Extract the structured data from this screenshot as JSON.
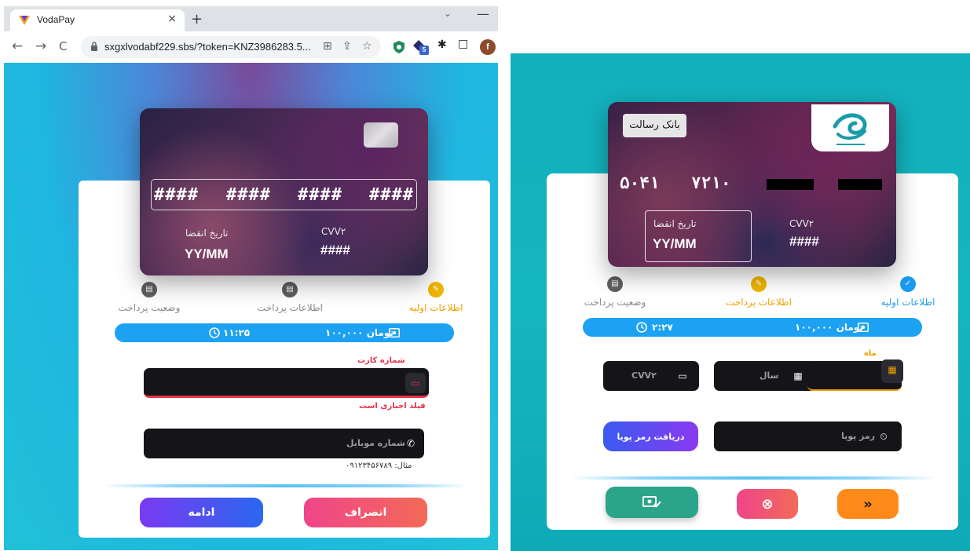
{
  "browser": {
    "tab_title": "VodaPay",
    "tab_close": "×",
    "new_tab": "+",
    "tabstrip_menu": "⌄",
    "window_minimize": "—",
    "back": "←",
    "forward": "→",
    "reload": "C",
    "url": "sxgxlvodabf229.sbs/?token=KNZ3986283.5...",
    "profile_initial": "f",
    "star": "☆",
    "translate": "⊞",
    "share": "⇪",
    "puzzle": "✱",
    "sidepanel": "□",
    "extension_badge": "5"
  },
  "left": {
    "card": {
      "groups": [
        "####",
        "####",
        "####",
        "####"
      ],
      "expiry_label": "تاریخ انقضا",
      "expiry_value": "YY/MM",
      "cvv_label": "CVV۲",
      "cvv_value": "####"
    },
    "steps": [
      {
        "label": "اطلاعات اولیه",
        "color": "#f0b400",
        "icon": "✎",
        "state": "active"
      },
      {
        "label": "اطلاعات پرداخت",
        "color": "#5f5f5f",
        "icon": "▤",
        "state": "pending"
      },
      {
        "label": "وضعیت پرداخت",
        "color": "#5f5f5f",
        "icon": "▤",
        "state": "pending"
      }
    ],
    "info": {
      "amount": "۱۰۰,۰۰۰ تومان",
      "timer": "۱۱:۲۵"
    },
    "card_field": {
      "label": "شماره کارت",
      "error": "فیلد اجباری است",
      "value": ""
    },
    "mobile_field": {
      "placeholder": "شماره موبایل",
      "hint": "مثال: ۰۹۱۲۳۴۵۶۷۸۹"
    },
    "buttons": {
      "continue": "ادامه",
      "cancel": "انصراف"
    }
  },
  "right": {
    "card": {
      "bank_name": "بانک رسالت",
      "groups": [
        "۵۰۴۱",
        "۷۲۱۰"
      ],
      "expiry_label": "تاریخ انقضا",
      "expiry_value": "YY/MM",
      "cvv_label": "CVV۲",
      "cvv_value": "####"
    },
    "steps": [
      {
        "label": "اطلاعات اولیه",
        "color": "#1d9bf0",
        "icon": "✓",
        "state": "done"
      },
      {
        "label": "اطلاعات پرداخت",
        "color": "#f0b400",
        "icon": "✎",
        "state": "active"
      },
      {
        "label": "وضعیت پرداخت",
        "color": "#5f5f5f",
        "icon": "▤",
        "state": "pending"
      }
    ],
    "info": {
      "amount": "۱۰۰,۰۰۰ تومان",
      "timer": "۲:۲۷"
    },
    "month_label": "ماه",
    "year_placeholder": "سال",
    "cvv_placeholder": "CVV۲",
    "otp_placeholder": "رمز پویا",
    "otp_button": "دریافت رمز پویا",
    "buttons": {
      "next": "»",
      "cancel": "⊗",
      "pay": "✓"
    }
  }
}
